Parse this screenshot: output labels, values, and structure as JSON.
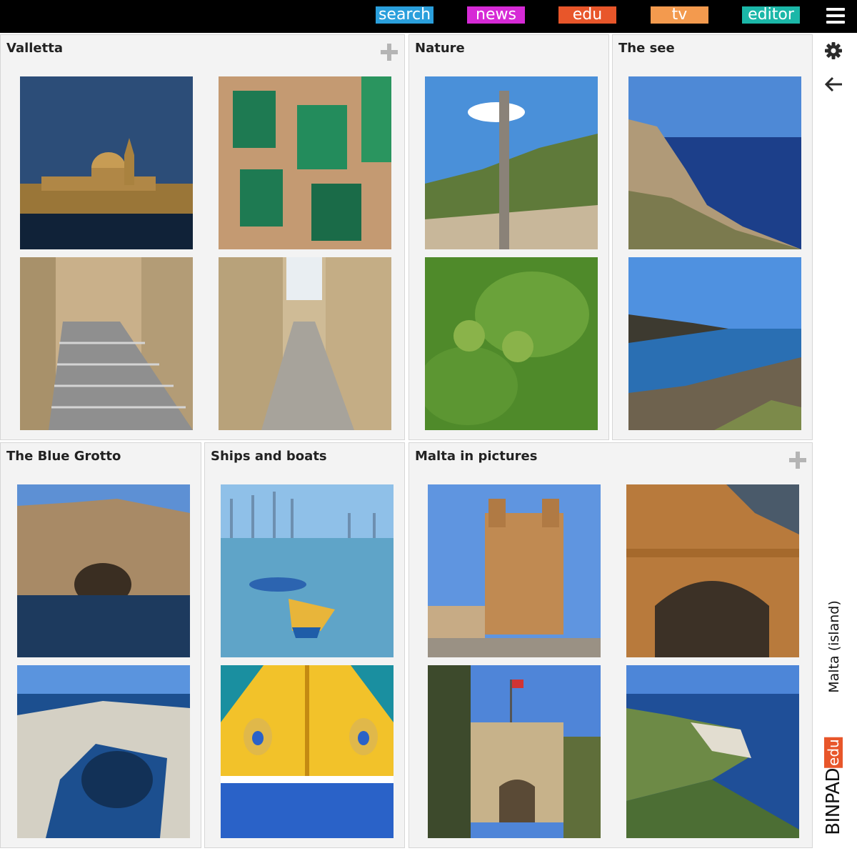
{
  "nav": {
    "tabs": [
      {
        "label": "search",
        "color": "#2a9fdc"
      },
      {
        "label": "news",
        "color": "#d62ad6"
      },
      {
        "label": "edu",
        "color": "#e8562a"
      },
      {
        "label": "tv",
        "color": "#f39a4e"
      },
      {
        "label": "editor",
        "color": "#1bb7a8"
      }
    ],
    "menu_icon": "hamburger-menu-icon"
  },
  "sidebar": {
    "icons": [
      "gear-icon",
      "arrow-left-icon"
    ],
    "page_title": "Malta (island)",
    "brand": {
      "part1": "BINPAD",
      "part2": "edu",
      "accent": "#e8562a"
    }
  },
  "panels": [
    {
      "title": "Valletta",
      "images": [
        "Valletta skyline with cathedral dome",
        "Green wooden balconies",
        "Stepped street",
        "Narrow alley"
      ]
    },
    {
      "title": "Nature",
      "images": [
        "Wooden pole on rocky hillside",
        "Green figs on fig tree"
      ]
    },
    {
      "title": "The see",
      "images": [
        "Sea cliffs",
        "Rocky coastline"
      ]
    },
    {
      "title": "The Blue Grotto",
      "images": [
        "Blue Grotto cliff",
        "Blue Grotto arch"
      ]
    },
    {
      "title": "Ships and boats",
      "images": [
        "Luzzu boats in harbour",
        "Painted eye on boat bow"
      ]
    },
    {
      "title": "Malta in pictures",
      "images": [
        "Baroque church",
        "Stone archway",
        "City gate with flag",
        "Coastal cliffs and terraces"
      ]
    }
  ]
}
